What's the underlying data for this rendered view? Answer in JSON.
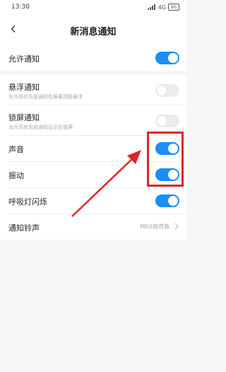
{
  "status_bar": {
    "time": "13:30",
    "network": "4G",
    "battery": "80"
  },
  "header": {
    "title": "新消息通知"
  },
  "settings": {
    "allow": {
      "label": "允许通知",
      "on": true
    },
    "floating": {
      "label": "悬浮通知",
      "sub": "允许高优先级通知在屏幕顶部悬浮",
      "on": false
    },
    "lockscreen": {
      "label": "锁屏通知",
      "sub": "允许高优先级通知显示在锁屏",
      "on": false
    },
    "sound": {
      "label": "声音",
      "on": true
    },
    "vibrate": {
      "label": "振动",
      "on": true
    },
    "breathing_light": {
      "label": "呼吸灯闪烁",
      "on": true
    },
    "ringtone": {
      "label": "通知铃声",
      "value": "MIUI自然音"
    }
  },
  "colors": {
    "accent": "#1c8ef7",
    "annotation": "#e02424"
  }
}
